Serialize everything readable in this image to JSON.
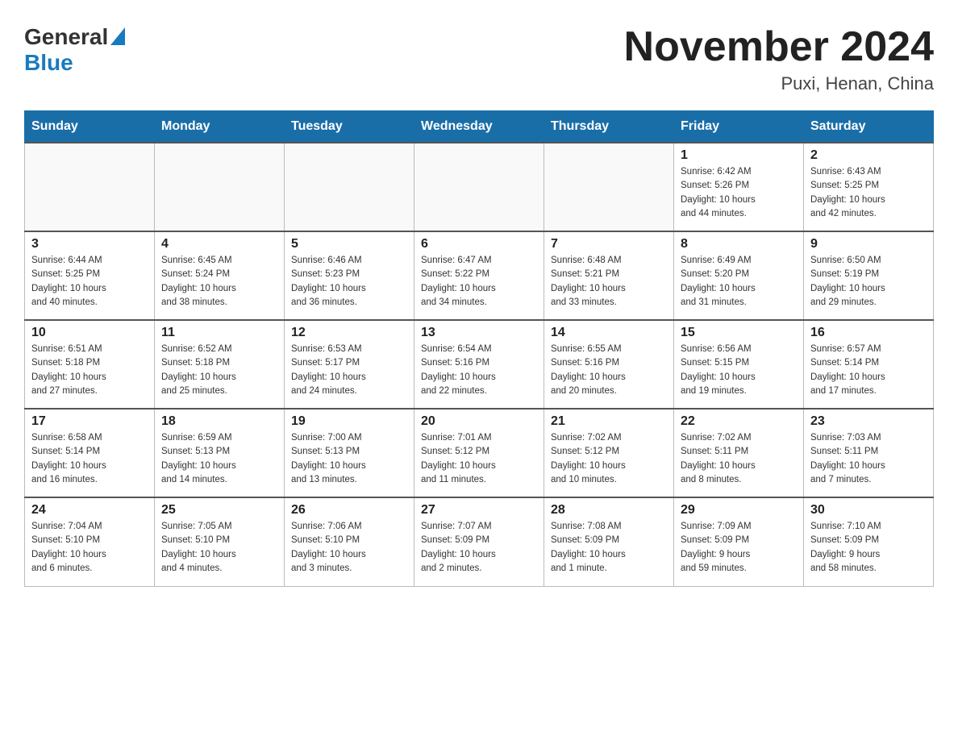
{
  "header": {
    "logo": {
      "general": "General",
      "blue": "Blue",
      "arrow": "▲"
    },
    "title": "November 2024",
    "location": "Puxi, Henan, China"
  },
  "weekdays": [
    "Sunday",
    "Monday",
    "Tuesday",
    "Wednesday",
    "Thursday",
    "Friday",
    "Saturday"
  ],
  "weeks": [
    [
      {
        "day": "",
        "info": ""
      },
      {
        "day": "",
        "info": ""
      },
      {
        "day": "",
        "info": ""
      },
      {
        "day": "",
        "info": ""
      },
      {
        "day": "",
        "info": ""
      },
      {
        "day": "1",
        "info": "Sunrise: 6:42 AM\nSunset: 5:26 PM\nDaylight: 10 hours\nand 44 minutes."
      },
      {
        "day": "2",
        "info": "Sunrise: 6:43 AM\nSunset: 5:25 PM\nDaylight: 10 hours\nand 42 minutes."
      }
    ],
    [
      {
        "day": "3",
        "info": "Sunrise: 6:44 AM\nSunset: 5:25 PM\nDaylight: 10 hours\nand 40 minutes."
      },
      {
        "day": "4",
        "info": "Sunrise: 6:45 AM\nSunset: 5:24 PM\nDaylight: 10 hours\nand 38 minutes."
      },
      {
        "day": "5",
        "info": "Sunrise: 6:46 AM\nSunset: 5:23 PM\nDaylight: 10 hours\nand 36 minutes."
      },
      {
        "day": "6",
        "info": "Sunrise: 6:47 AM\nSunset: 5:22 PM\nDaylight: 10 hours\nand 34 minutes."
      },
      {
        "day": "7",
        "info": "Sunrise: 6:48 AM\nSunset: 5:21 PM\nDaylight: 10 hours\nand 33 minutes."
      },
      {
        "day": "8",
        "info": "Sunrise: 6:49 AM\nSunset: 5:20 PM\nDaylight: 10 hours\nand 31 minutes."
      },
      {
        "day": "9",
        "info": "Sunrise: 6:50 AM\nSunset: 5:19 PM\nDaylight: 10 hours\nand 29 minutes."
      }
    ],
    [
      {
        "day": "10",
        "info": "Sunrise: 6:51 AM\nSunset: 5:18 PM\nDaylight: 10 hours\nand 27 minutes."
      },
      {
        "day": "11",
        "info": "Sunrise: 6:52 AM\nSunset: 5:18 PM\nDaylight: 10 hours\nand 25 minutes."
      },
      {
        "day": "12",
        "info": "Sunrise: 6:53 AM\nSunset: 5:17 PM\nDaylight: 10 hours\nand 24 minutes."
      },
      {
        "day": "13",
        "info": "Sunrise: 6:54 AM\nSunset: 5:16 PM\nDaylight: 10 hours\nand 22 minutes."
      },
      {
        "day": "14",
        "info": "Sunrise: 6:55 AM\nSunset: 5:16 PM\nDaylight: 10 hours\nand 20 minutes."
      },
      {
        "day": "15",
        "info": "Sunrise: 6:56 AM\nSunset: 5:15 PM\nDaylight: 10 hours\nand 19 minutes."
      },
      {
        "day": "16",
        "info": "Sunrise: 6:57 AM\nSunset: 5:14 PM\nDaylight: 10 hours\nand 17 minutes."
      }
    ],
    [
      {
        "day": "17",
        "info": "Sunrise: 6:58 AM\nSunset: 5:14 PM\nDaylight: 10 hours\nand 16 minutes."
      },
      {
        "day": "18",
        "info": "Sunrise: 6:59 AM\nSunset: 5:13 PM\nDaylight: 10 hours\nand 14 minutes."
      },
      {
        "day": "19",
        "info": "Sunrise: 7:00 AM\nSunset: 5:13 PM\nDaylight: 10 hours\nand 13 minutes."
      },
      {
        "day": "20",
        "info": "Sunrise: 7:01 AM\nSunset: 5:12 PM\nDaylight: 10 hours\nand 11 minutes."
      },
      {
        "day": "21",
        "info": "Sunrise: 7:02 AM\nSunset: 5:12 PM\nDaylight: 10 hours\nand 10 minutes."
      },
      {
        "day": "22",
        "info": "Sunrise: 7:02 AM\nSunset: 5:11 PM\nDaylight: 10 hours\nand 8 minutes."
      },
      {
        "day": "23",
        "info": "Sunrise: 7:03 AM\nSunset: 5:11 PM\nDaylight: 10 hours\nand 7 minutes."
      }
    ],
    [
      {
        "day": "24",
        "info": "Sunrise: 7:04 AM\nSunset: 5:10 PM\nDaylight: 10 hours\nand 6 minutes."
      },
      {
        "day": "25",
        "info": "Sunrise: 7:05 AM\nSunset: 5:10 PM\nDaylight: 10 hours\nand 4 minutes."
      },
      {
        "day": "26",
        "info": "Sunrise: 7:06 AM\nSunset: 5:10 PM\nDaylight: 10 hours\nand 3 minutes."
      },
      {
        "day": "27",
        "info": "Sunrise: 7:07 AM\nSunset: 5:09 PM\nDaylight: 10 hours\nand 2 minutes."
      },
      {
        "day": "28",
        "info": "Sunrise: 7:08 AM\nSunset: 5:09 PM\nDaylight: 10 hours\nand 1 minute."
      },
      {
        "day": "29",
        "info": "Sunrise: 7:09 AM\nSunset: 5:09 PM\nDaylight: 9 hours\nand 59 minutes."
      },
      {
        "day": "30",
        "info": "Sunrise: 7:10 AM\nSunset: 5:09 PM\nDaylight: 9 hours\nand 58 minutes."
      }
    ]
  ]
}
